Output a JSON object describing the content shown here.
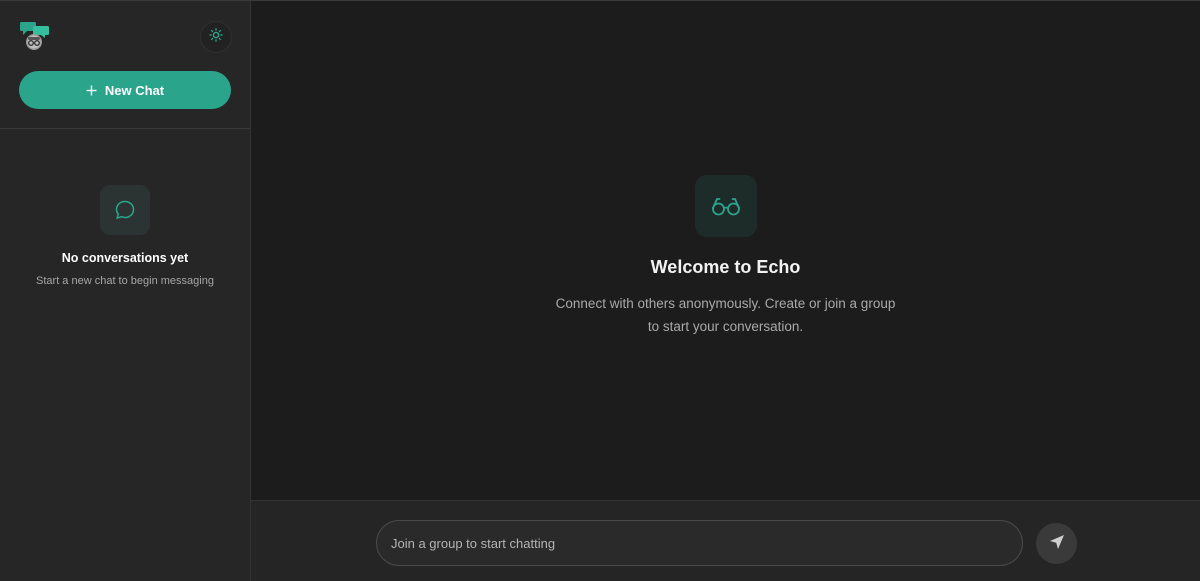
{
  "sidebar": {
    "logo_icon": "chat-bubbles-logo-icon",
    "theme_toggle_icon": "sun-icon",
    "new_chat_label": "New Chat",
    "new_chat_icon": "plus-icon",
    "empty_state": {
      "icon": "chat-bubble-icon",
      "title": "No conversations yet",
      "subtitle": "Start a new chat to begin messaging"
    }
  },
  "main": {
    "welcome_icon": "glasses-icon",
    "welcome_title": "Welcome to Echo",
    "welcome_desc": "Connect with others anonymously. Create or join a group to start your conversation."
  },
  "composer": {
    "placeholder": "Join a group to start chatting",
    "value": "",
    "send_icon": "send-icon"
  },
  "colors": {
    "accent": "#2aa58c",
    "background": "#1c1c1c",
    "sidebar": "#262626"
  }
}
